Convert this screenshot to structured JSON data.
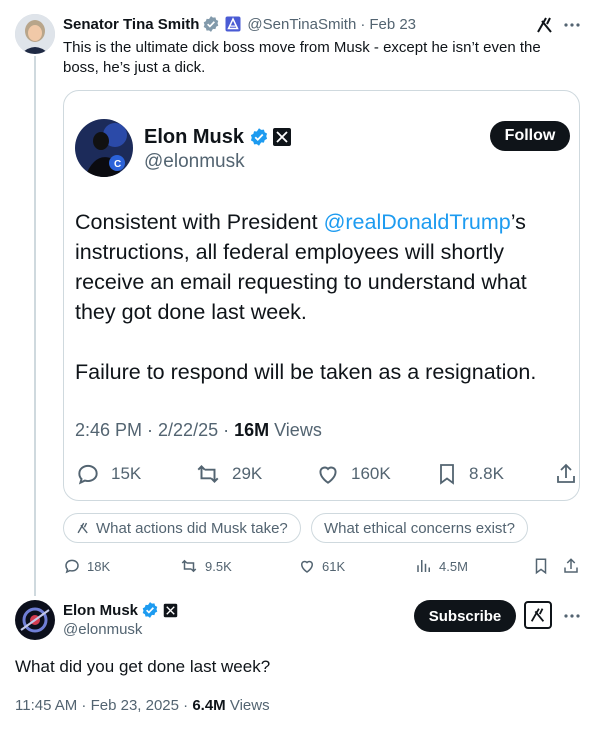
{
  "post": {
    "author_name": "Senator Tina Smith",
    "handle": "@SenTinaSmith",
    "separator": "·",
    "date": "Feb 23",
    "text": "This is the ultimate dick boss move from Musk - except he isn’t even the boss, he’s just a dick."
  },
  "quoted": {
    "author_name": "Elon Musk",
    "handle": "@elonmusk",
    "follow_label": "Follow",
    "text_before_mention": "Consistent with President ",
    "mention": "@realDonaldTrump",
    "text_after_mention": "’s instructions, all federal employees will shortly receive an email requesting to understand what they got done last week.",
    "text_para2": "Failure to respond will be taken as a resignation.",
    "timestamp": "2:46 PM · 2/22/25 · ",
    "views_count": "16M",
    "views_label": "Views",
    "actions": {
      "replies": "15K",
      "reposts": "29K",
      "likes": "160K",
      "bookmarks": "8.8K"
    }
  },
  "grok_prompts": [
    "What actions did Musk take?",
    "What ethical concerns exist?"
  ],
  "post_actions": {
    "replies": "18K",
    "reposts": "9.5K",
    "likes": "61K",
    "views": "4.5M"
  },
  "reply": {
    "author_name": "Elon Musk",
    "handle": "@elonmusk",
    "subscribe_label": "Subscribe",
    "text": "What did you get done last week?",
    "timestamp": "11:45 AM · Feb 23, 2025 · ",
    "views_count": "6.4M",
    "views_label": "Views"
  },
  "colors": {
    "verified_blue": "#1d9bf0",
    "mention_blue": "#1d9bf0",
    "text_dark": "#0f1419",
    "text_muted": "#536471",
    "border": "#cfd9de"
  },
  "icons": [
    "verified-icon",
    "government-badge-icon",
    "grok-icon",
    "more-icon",
    "x-logo-icon",
    "reply-icon",
    "repost-icon",
    "like-icon",
    "bookmark-icon",
    "share-icon",
    "views-icon"
  ]
}
